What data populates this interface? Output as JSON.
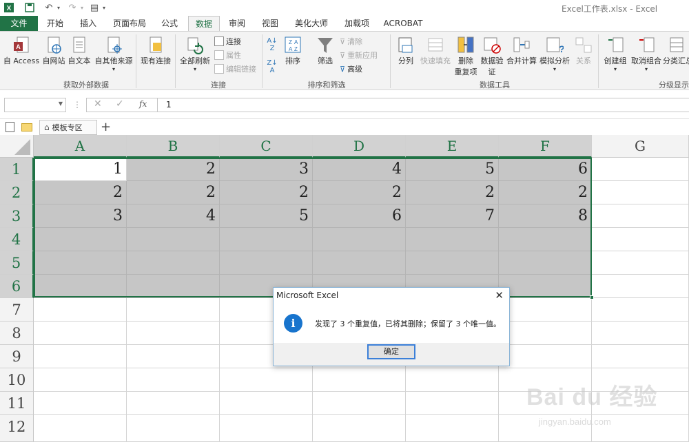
{
  "window": {
    "title": "Excel工作表.xlsx - Excel"
  },
  "tabs": [
    "文件",
    "开始",
    "插入",
    "页面布局",
    "公式",
    "数据",
    "审阅",
    "视图",
    "美化大师",
    "加载项",
    "ACROBAT"
  ],
  "active_tab": "数据",
  "ribbon": {
    "groups": {
      "external": "获取外部数据",
      "connections": "连接",
      "sort_filter": "排序和筛选",
      "data_tools": "数据工具",
      "outline": "分级显示"
    },
    "external_buttons": [
      "自 Access",
      "自网站",
      "自文本",
      "自其他来源",
      "现有连接"
    ],
    "refresh_all": "全部刷新",
    "conn_small": [
      "连接",
      "属性",
      "编辑链接"
    ],
    "sort": "排序",
    "filter": "筛选",
    "filter_small": [
      "清除",
      "重新应用",
      "高级"
    ],
    "split": "分列",
    "flash_fill": "快速填充",
    "remove_dup_1": "删除",
    "remove_dup_2": "重复项",
    "validation_1": "数据验",
    "validation_2": "证",
    "consolidate": "合并计算",
    "whatif": "模拟分析",
    "relations": "关系",
    "group": "创建组",
    "ungroup": "取消组合",
    "subtotal": "分类汇总"
  },
  "formula_bar": {
    "fx": "fx",
    "value": "1"
  },
  "sheet_strip": {
    "template_tab": "模板专区",
    "add": "+"
  },
  "grid": {
    "columns": [
      "A",
      "B",
      "C",
      "D",
      "E",
      "F",
      "G"
    ],
    "rows": [
      "1",
      "2",
      "3",
      "4",
      "5",
      "6",
      "7",
      "8",
      "9",
      "10",
      "11",
      "12"
    ],
    "cells": [
      [
        "1",
        "2",
        "3",
        "4",
        "5",
        "6"
      ],
      [
        "2",
        "2",
        "2",
        "2",
        "2",
        "2"
      ],
      [
        "3",
        "4",
        "5",
        "6",
        "7",
        "8"
      ]
    ]
  },
  "dialog": {
    "title": "Microsoft Excel",
    "message": "发现了 3 个重复值，已将其删除；保留了 3 个唯一值。",
    "ok": "确定"
  },
  "watermark": {
    "brand": "Bai du 经验",
    "url": "jingyan.baidu.com"
  },
  "colors": {
    "excel_green": "#217346",
    "selection_fill": "#c6c6c6",
    "info_blue": "#1874cd"
  }
}
